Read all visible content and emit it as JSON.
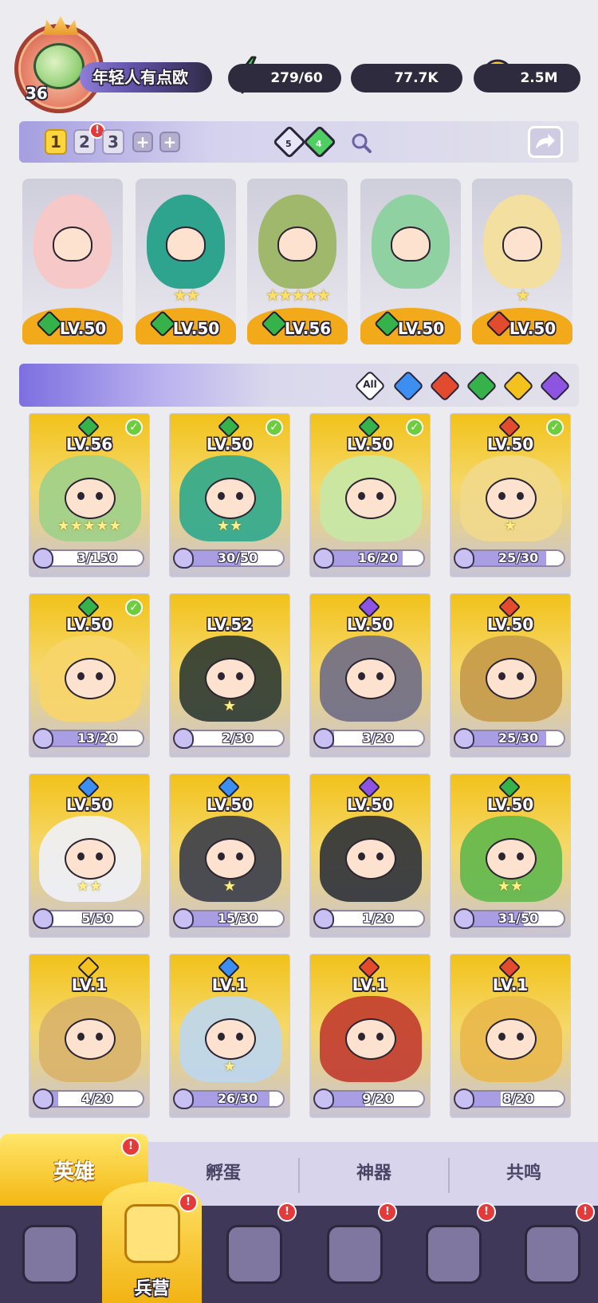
{
  "player": {
    "level": "36",
    "name": "年轻人有点欧"
  },
  "resources": {
    "energy": "279/60",
    "gems": "77.7K",
    "gold": "2.5M"
  },
  "teams": {
    "tabs": [
      "1",
      "2",
      "3"
    ],
    "add": "+",
    "notif_badge": "!",
    "gem_counts": [
      "5",
      "4"
    ]
  },
  "team_lineup": [
    {
      "level": "LV.50",
      "element": "green",
      "stars": ""
    },
    {
      "level": "LV.50",
      "element": "green",
      "stars": "★★"
    },
    {
      "level": "LV.56",
      "element": "green",
      "stars": "★★★★★"
    },
    {
      "level": "LV.50",
      "element": "green",
      "stars": ""
    },
    {
      "level": "LV.50",
      "element": "red",
      "stars": "★"
    }
  ],
  "filters": {
    "all": "All"
  },
  "colors": {
    "green": "#35b34a",
    "blue": "#3c8ef0",
    "red": "#e34b2f",
    "gold": "#f4c21f",
    "purple": "#8c54e0",
    "accent": "#f4b713"
  },
  "heroes": [
    {
      "level": "LV.56",
      "shards": "3/150",
      "progress": 0.02,
      "element": "green",
      "checked": true,
      "palette": "#9fd08a",
      "stars": "★★★★★"
    },
    {
      "level": "LV.50",
      "shards": "30/50",
      "progress": 0.6,
      "element": "green",
      "checked": true,
      "palette": "#2fa88d",
      "stars": "★★"
    },
    {
      "level": "LV.50",
      "shards": "16/20",
      "progress": 0.8,
      "element": "green",
      "checked": true,
      "palette": "#c7e8a6",
      "stars": ""
    },
    {
      "level": "LV.50",
      "shards": "25/30",
      "progress": 0.83,
      "element": "red",
      "checked": true,
      "palette": "#f1d98c",
      "stars": "★"
    },
    {
      "level": "LV.50",
      "shards": "13/20",
      "progress": 0.65,
      "element": "green",
      "checked": true,
      "palette": "#f8d56a",
      "stars": ""
    },
    {
      "level": "LV.52",
      "shards": "2/30",
      "progress": 0.07,
      "element": "",
      "checked": false,
      "palette": "#2d3a32",
      "stars": "★"
    },
    {
      "level": "LV.50",
      "shards": "3/20",
      "progress": 0.15,
      "element": "purple",
      "checked": false,
      "palette": "#6f6d86",
      "stars": ""
    },
    {
      "level": "LV.50",
      "shards": "25/30",
      "progress": 0.83,
      "element": "red",
      "checked": false,
      "palette": "#c59a4a",
      "stars": ""
    },
    {
      "level": "LV.50",
      "shards": "5/50",
      "progress": 0.1,
      "element": "blue",
      "checked": false,
      "palette": "#eef1fb",
      "stars": "★★"
    },
    {
      "level": "LV.50",
      "shards": "15/30",
      "progress": 0.5,
      "element": "blue",
      "checked": false,
      "palette": "#3a3d4a",
      "stars": "★"
    },
    {
      "level": "LV.50",
      "shards": "1/20",
      "progress": 0.05,
      "element": "purple",
      "checked": false,
      "palette": "#2e3138",
      "stars": ""
    },
    {
      "level": "LV.50",
      "shards": "31/50",
      "progress": 0.62,
      "element": "green",
      "checked": false,
      "palette": "#61b84d",
      "stars": "★★"
    },
    {
      "level": "LV.1",
      "shards": "4/20",
      "progress": 0.2,
      "element": "gold",
      "checked": false,
      "palette": "#d9b26a",
      "stars": ""
    },
    {
      "level": "LV.1",
      "shards": "26/30",
      "progress": 0.87,
      "element": "blue",
      "checked": false,
      "palette": "#bcd7ef",
      "stars": "★"
    },
    {
      "level": "LV.1",
      "shards": "9/20",
      "progress": 0.45,
      "element": "red",
      "checked": false,
      "palette": "#c23b2f",
      "stars": ""
    },
    {
      "level": "LV.1",
      "shards": "8/20",
      "progress": 0.4,
      "element": "red",
      "checked": false,
      "palette": "#e9b84a",
      "stars": ""
    }
  ],
  "subtabs": [
    "英雄",
    "孵蛋",
    "神器",
    "共鸣"
  ],
  "bottomnav": {
    "active_label": "兵营"
  }
}
